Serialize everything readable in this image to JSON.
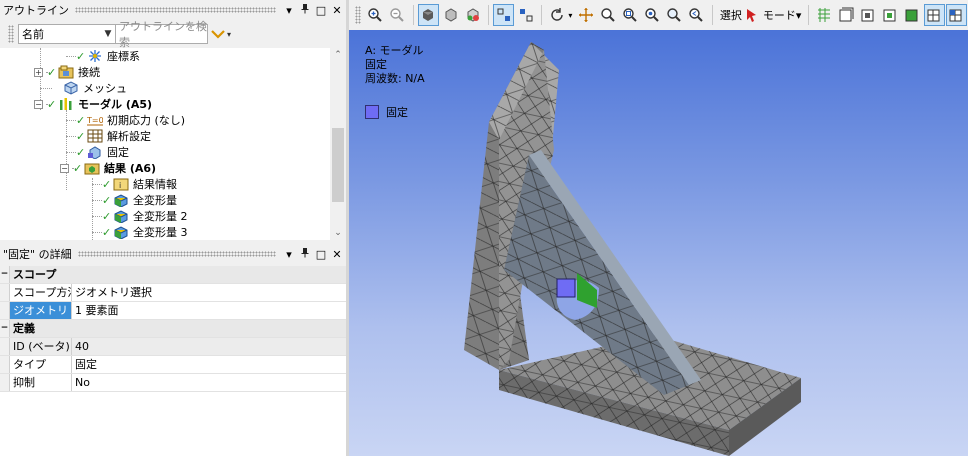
{
  "outline": {
    "title": "アウトライン",
    "name_combo": "名前",
    "search_placeholder": "アウトラインを検索",
    "scroll_up": "⌃",
    "scroll_down": "⌄",
    "tree": [
      {
        "label": "座標系",
        "bold": false,
        "icon": "coordinate-system-icon"
      },
      {
        "label": "接続",
        "bold": false,
        "icon": "connections-icon"
      },
      {
        "label": "メッシュ",
        "bold": false,
        "icon": "mesh-icon"
      },
      {
        "label": "モーダル (A5)",
        "bold": true,
        "icon": "modal-analysis-icon"
      },
      {
        "label": "初期応力 (なし)",
        "bold": false,
        "icon": "initial-stress-icon"
      },
      {
        "label": "解析設定",
        "bold": false,
        "icon": "analysis-settings-icon"
      },
      {
        "label": "固定",
        "bold": false,
        "icon": "fixed-support-icon"
      },
      {
        "label": "結果 (A6)",
        "bold": true,
        "icon": "solution-icon"
      },
      {
        "label": "結果情報",
        "bold": false,
        "icon": "solution-information-icon"
      },
      {
        "label": "全変形量",
        "bold": false,
        "icon": "total-deformation-icon"
      },
      {
        "label": "全変形量 2",
        "bold": false,
        "icon": "total-deformation-icon"
      },
      {
        "label": "全変形量 3",
        "bold": false,
        "icon": "total-deformation-icon"
      }
    ]
  },
  "details": {
    "title": "\"固定\" の詳細",
    "scope_header": "スコープ",
    "scope_method_key": "スコープ方法",
    "scope_method_value": "ジオメトリ選択",
    "geometry_key": "ジオメトリ",
    "geometry_value": "1 要素面",
    "definition_header": "定義",
    "id_key": "ID (ベータ)",
    "id_value": "40",
    "type_key": "タイプ",
    "type_value": "固定",
    "suppressed_key": "抑制",
    "suppressed_value": "No"
  },
  "panel_controls": {
    "dropdown": "▾",
    "pin": "ᚹ",
    "maximize": "□",
    "close": "✕"
  },
  "toolbar": {
    "select_label": "選択",
    "mode_label": "モード▾"
  },
  "viewport": {
    "analysis_title": "A: モーダル",
    "object_name": "固定",
    "frequency": "周波数: N/A",
    "legend_label": "固定",
    "legend_color": "#6f6cf4",
    "background_top": "#4b73d8",
    "background_bottom": "#c9d5f4"
  }
}
